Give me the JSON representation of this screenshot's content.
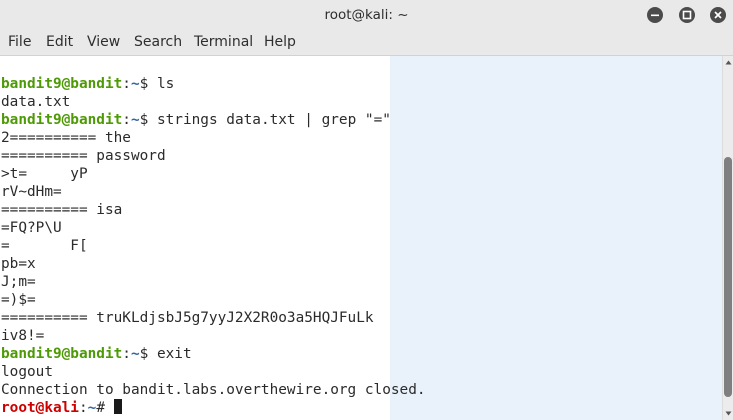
{
  "window": {
    "title": "root@kali: ~",
    "buttons": [
      "minimize-icon",
      "maximize-icon",
      "close-icon"
    ]
  },
  "menu": {
    "items": [
      "File",
      "Edit",
      "View",
      "Search",
      "Terminal",
      "Help"
    ]
  },
  "terminal": {
    "lines": [
      {
        "user": "bandit9@bandit",
        "path": "~",
        "sym": "$",
        "cmd": " ls"
      },
      {
        "text": "data.txt"
      },
      {
        "user": "bandit9@bandit",
        "path": "~",
        "sym": "$",
        "cmd": " strings data.txt | grep \"=\""
      },
      {
        "text": "2========== the"
      },
      {
        "text": "========== password"
      },
      {
        "text": ">t=     yP"
      },
      {
        "text": "rV~dHm="
      },
      {
        "text": "========== isa"
      },
      {
        "text": "=FQ?P\\U"
      },
      {
        "text": "=       F["
      },
      {
        "text": "pb=x"
      },
      {
        "text": "J;m="
      },
      {
        "text": "=)$="
      },
      {
        "text": "========== truKLdjsbJ5g7yyJ2X2R0o3a5HQJFuLk"
      },
      {
        "text": "iv8!="
      },
      {
        "user": "bandit9@bandit",
        "path": "~",
        "sym": "$",
        "cmd": " exit"
      },
      {
        "text": "logout"
      },
      {
        "text": "Connection to bandit.labs.overthewire.org closed."
      },
      {
        "root": "root@kali",
        "path": "~",
        "sym": "#",
        "cmd": " ",
        "cursor": true
      }
    ]
  },
  "colors": {
    "user_prompt": "#4e9a06",
    "root_prompt": "#cc0000",
    "path": "#3465a4",
    "right_panel_tint": "#e9f2fb"
  }
}
